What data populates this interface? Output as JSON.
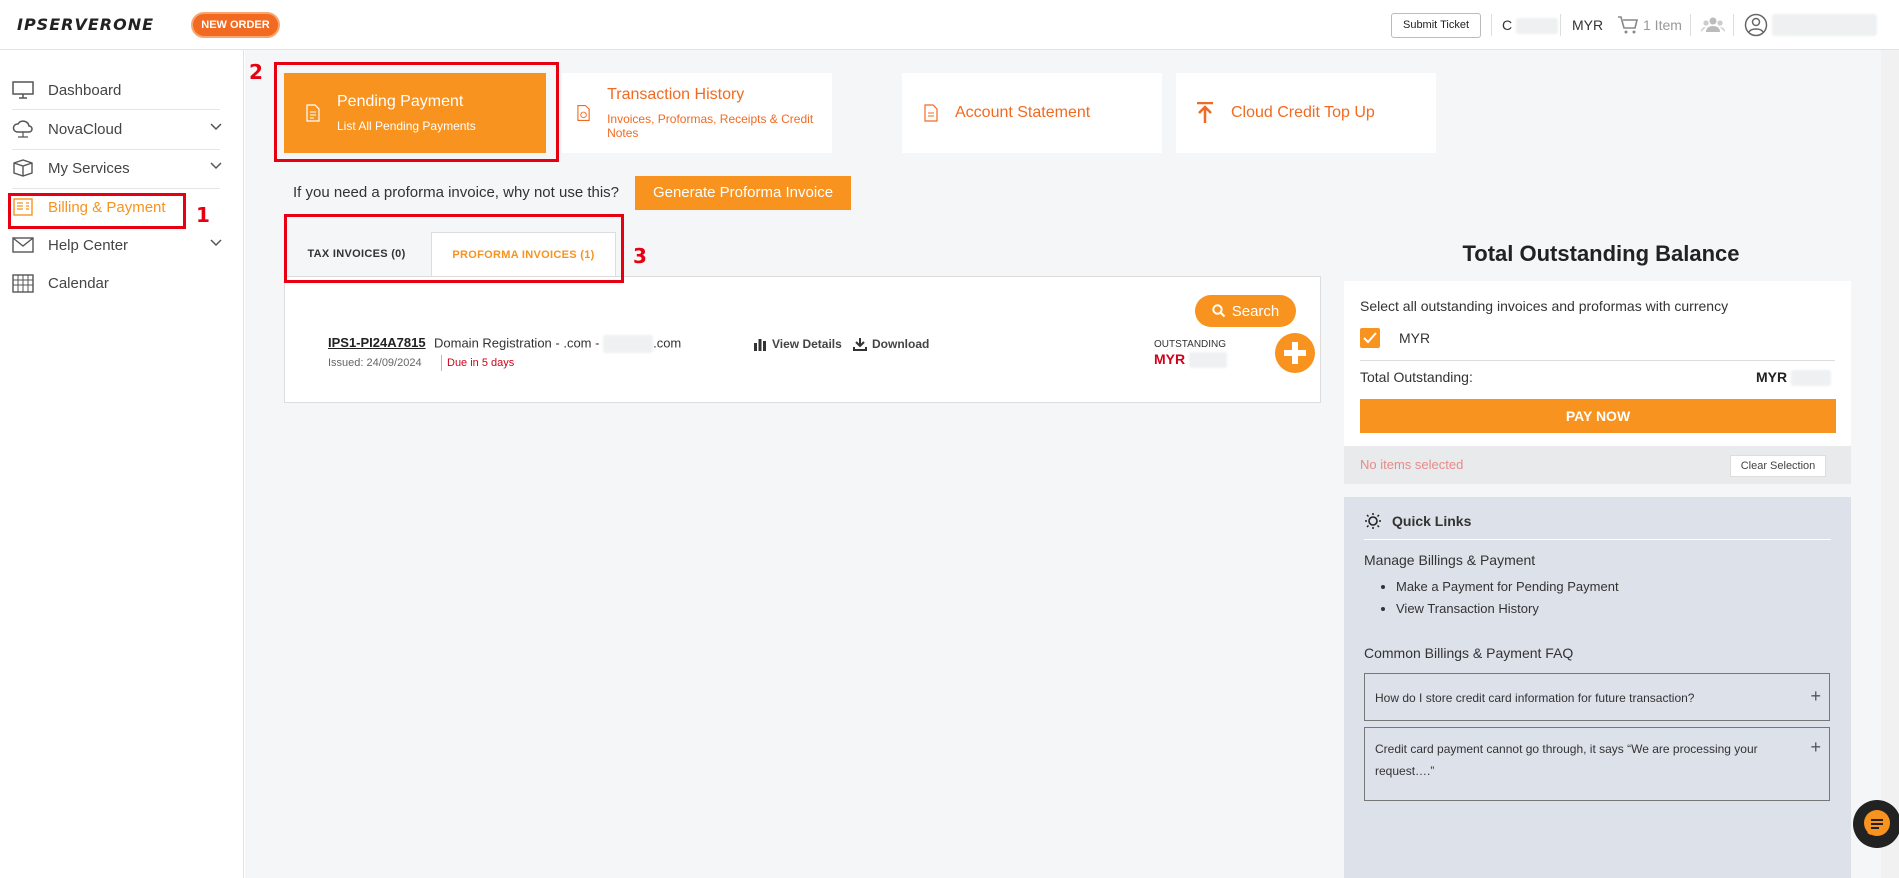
{
  "topbar": {
    "logo_text": "IPSERVERONE",
    "new_order_label": "NEW ORDER",
    "submit_ticket_label": "Submit Ticket",
    "credit_prefix": "C",
    "currency": "MYR",
    "cart_label": "1 Item"
  },
  "sidebar": {
    "items": [
      {
        "label": "Dashboard",
        "icon": "monitor-icon"
      },
      {
        "label": "NovaCloud",
        "icon": "cloud-icon"
      },
      {
        "label": "My Services",
        "icon": "box-icon"
      },
      {
        "label": "Billing & Payment",
        "icon": "billing-icon",
        "active": true
      },
      {
        "label": "Help Center",
        "icon": "mail-icon"
      },
      {
        "label": "Calendar",
        "icon": "calendar-icon"
      }
    ]
  },
  "tiles": {
    "pending": {
      "title": "Pending Payment",
      "sub": "List All Pending Payments"
    },
    "history": {
      "title": "Transaction History",
      "sub": "Invoices, Proformas, Receipts & Credit Notes"
    },
    "statement": {
      "title": "Account Statement"
    },
    "topup": {
      "title": "Cloud Credit Top Up"
    }
  },
  "proforma_prompt": {
    "question": "If you need a proforma invoice, why not use this?",
    "button": "Generate Proforma Invoice"
  },
  "tabs": {
    "tax": "TAX INVOICES (0)",
    "proforma": "PROFORMA INVOICES (1)"
  },
  "invoice": {
    "search_label": "Search",
    "number": "IPS1-PI24A7815",
    "description_prefix": "Domain Registration - .com -",
    "description_suffix": ".com",
    "issued": "Issued: 24/09/2024",
    "due": "Due in 5 days",
    "view_details": "View Details",
    "download": "Download",
    "outstanding_label": "OUTSTANDING",
    "outstanding_currency": "MYR"
  },
  "balance": {
    "title": "Total Outstanding Balance",
    "select_text": "Select all outstanding invoices and proformas with currency",
    "currency_option": "MYR",
    "total_label": "Total Outstanding:",
    "total_currency": "MYR",
    "pay_now": "PAY NOW",
    "no_items": "No items selected",
    "clear_selection": "Clear Selection"
  },
  "quick_links": {
    "title": "Quick Links",
    "billing_heading": "Manage Billings & Payment",
    "links": [
      "Make a Payment for Pending Payment",
      "View Transaction History"
    ],
    "faq_heading": "Common Billings & Payment FAQ",
    "faqs": [
      "How do I store credit card information for future transaction?",
      "Credit card payment cannot go through, it says “We are processing your request….”"
    ]
  },
  "annotations": [
    "1",
    "2",
    "3"
  ],
  "colors": {
    "accent": "#f7931e",
    "brand_orange": "#f26a21",
    "annotation_red": "#e60012",
    "due_red": "#d0021b"
  }
}
